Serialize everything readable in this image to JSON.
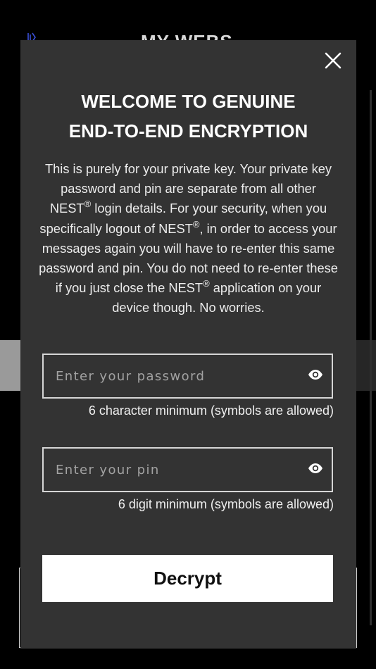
{
  "background": {
    "title": "MY WEBS",
    "logo_icon": "nest-logo-icon"
  },
  "modal": {
    "close_icon": "close-icon",
    "title_line1": "WELCOME TO GENUINE",
    "title_line2": "END-TO-END ENCRYPTION",
    "description": {
      "part1": "This is purely for your private key. Your private key password and pin are separate from all other NEST",
      "part2": " login details. For your security, when you specifically logout of NEST",
      "part3": ", in order to access your messages again you will have to re-enter this same password and pin. You do not need to re-enter these if you just close the NEST",
      "part4": " application on your device though. No worries.",
      "registered_mark": "®"
    },
    "password_field": {
      "placeholder": "Enter your password",
      "value": "",
      "toggle_icon": "eye-icon",
      "hint": "6 character minimum (symbols are allowed)"
    },
    "pin_field": {
      "placeholder": "Enter your pin",
      "value": "",
      "toggle_icon": "eye-icon",
      "hint": "6 digit minimum (symbols are allowed)"
    },
    "decrypt_label": "Decrypt"
  },
  "colors": {
    "overlay_bg": "#000000",
    "modal_bg": "#333333",
    "text": "#ffffff",
    "button_bg": "#ffffff",
    "button_text": "#111111",
    "logo_accent": "#3a4fd8"
  }
}
